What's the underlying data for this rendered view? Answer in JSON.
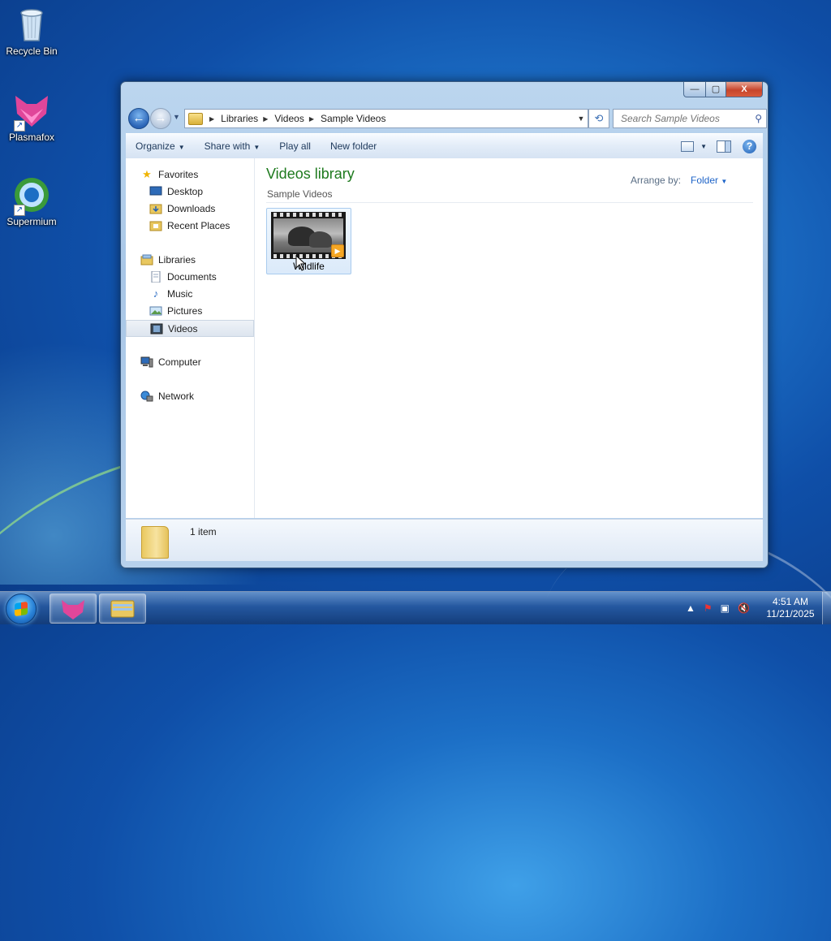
{
  "desktop": {
    "icons": [
      {
        "label": "Recycle Bin"
      },
      {
        "label": "Plasmafox"
      },
      {
        "label": "Supermium"
      }
    ]
  },
  "window": {
    "caption_buttons": {
      "minimize": "—",
      "maximize": "▢",
      "close": "X"
    },
    "address": {
      "crumbs": [
        "Libraries",
        "Videos",
        "Sample Videos"
      ]
    },
    "search": {
      "placeholder": "Search Sample Videos"
    },
    "toolbar": {
      "organize": "Organize",
      "share_with": "Share with",
      "play_all": "Play all",
      "new_folder": "New folder"
    },
    "nav_pane": {
      "favorites": "Favorites",
      "desktop": "Desktop",
      "downloads": "Downloads",
      "recent_places": "Recent Places",
      "libraries": "Libraries",
      "documents": "Documents",
      "music": "Music",
      "pictures": "Pictures",
      "videos": "Videos",
      "computer": "Computer",
      "network": "Network"
    },
    "content": {
      "title": "Videos library",
      "subtitle": "Sample Videos",
      "arrange_label": "Arrange by:",
      "arrange_value": "Folder",
      "items": [
        {
          "name": "Wildlife"
        }
      ]
    },
    "details": {
      "count": "1 item"
    }
  },
  "taskbar": {
    "clock_time": "4:51 AM",
    "clock_date": "11/21/2025"
  },
  "colors": {
    "library_title": "#1e7a1e",
    "link_blue": "#1e64c8",
    "close_red": "#c7452c"
  }
}
